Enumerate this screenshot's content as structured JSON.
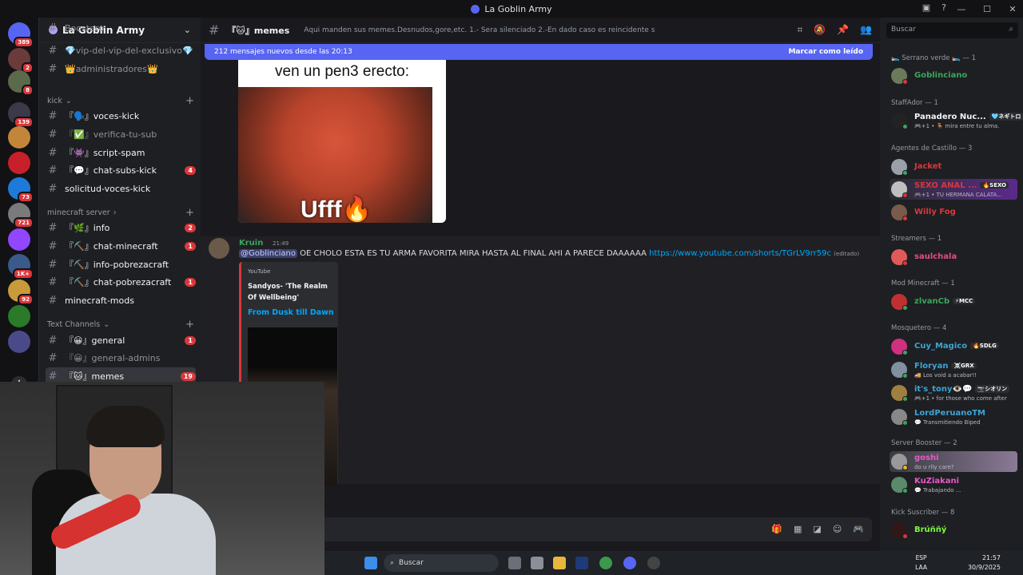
{
  "window": {
    "title": "La Goblin Army"
  },
  "servers": [
    {
      "badge": "389",
      "color": "#5865f2"
    },
    {
      "badge": "2",
      "color": "#6b3a3a"
    },
    {
      "badge": "8",
      "color": "#5a6a4a"
    },
    {
      "badge": "139",
      "color": "#3a3a4a"
    },
    {
      "badge": "",
      "color": "#c2853a"
    },
    {
      "badge": "",
      "color": "#c8202a"
    },
    {
      "badge": "73",
      "color": "#1e7ad8"
    },
    {
      "badge": "721",
      "color": "#7a7a7a"
    },
    {
      "badge": "",
      "color": "#9146ff"
    },
    {
      "badge": "1K+",
      "color": "#3a5a8a"
    },
    {
      "badge": "92",
      "color": "#c89a3a"
    },
    {
      "badge": "",
      "color": "#2a7a2a"
    },
    {
      "badge": "",
      "color": "#4a4a8a"
    }
  ],
  "guild": {
    "name": "La Goblin Army"
  },
  "channels": {
    "top": [
      {
        "label": "Boostero",
        "dim": true
      },
      {
        "label": "💎vip-del-vip-del-exclusivo💎",
        "dim": true
      },
      {
        "label": "👑administradores👑",
        "dim": true
      }
    ],
    "categories": [
      {
        "label": "kick",
        "chevron": "⌄"
      },
      {
        "label": "minecraft server",
        "chevron": "›"
      },
      {
        "label": "Text Channels",
        "chevron": "⌄"
      }
    ],
    "kick": [
      {
        "label": "『🗣️』voces-kick",
        "badge": "",
        "dim": false
      },
      {
        "label": "『✅』verifica-tu-sub",
        "badge": "",
        "dim": true
      },
      {
        "label": "『👾』script-spam",
        "badge": "",
        "dim": false
      },
      {
        "label": "『💬』chat-subs-kick",
        "badge": "4",
        "dim": false
      },
      {
        "label": "solicitud-voces-kick",
        "badge": "",
        "dim": false
      }
    ],
    "minecraft": [
      {
        "label": "『🌿』info",
        "badge": "2"
      },
      {
        "label": "『⛏️』chat-minecraft",
        "badge": "1"
      },
      {
        "label": "『⛏️』info-pobrezacraft",
        "badge": ""
      },
      {
        "label": "『⛏️』chat-pobrezacraft",
        "badge": "1"
      },
      {
        "label": "minecraft-mods",
        "badge": ""
      }
    ],
    "text": [
      {
        "label": "『😀』general",
        "badge": "1",
        "dim": false
      },
      {
        "label": "『😀』general-admins",
        "badge": "",
        "dim": true
      },
      {
        "label": "『🐱』memes",
        "badge": "19",
        "dim": false
      }
    ]
  },
  "topbar": {
    "channel": "『🐱』memes",
    "topic": "Aqui manden sus memes.Desnudos,gore,etc. 1.- Sera silenciado 2.-En dado caso es reincidente sera baneado"
  },
  "newbar": {
    "text": "212 mensajes nuevos desde las 20:13",
    "mark": "Marcar como leído"
  },
  "meme": {
    "caption": "ven un pen3 erecto:",
    "overlay": "Ufff🔥"
  },
  "message": {
    "author": "Kruin",
    "time": "21:49",
    "mention": "@Goblinciano",
    "text": " OE CHOLO ESTA ES TU ARMA FAVORITA MIRA HASTA AL FINAL AHI A PARECE DAAAAAA ",
    "link": "https://www.youtube.com/shorts/TGrLV9rr59c",
    "edited": "(editado)",
    "embed": {
      "provider": "YouTube",
      "title": "Sandyos- 'The Realm Of Wellbeing'",
      "link": "From Dusk till Dawn"
    }
  },
  "search": {
    "placeholder": "Buscar"
  },
  "members": {
    "groups": [
      {
        "header": "🛌 Serrano verde 🛌 — 1"
      },
      {
        "header": "StaffAdor — 1"
      },
      {
        "header": "Agentes de Castillo — 3"
      },
      {
        "header": "Streamers — 1"
      },
      {
        "header": "Mod Minecraft — 1"
      },
      {
        "header": "Mosquetero — 4"
      },
      {
        "header": "Server Booster — 2"
      },
      {
        "header": "Kick Suscriber — 8"
      }
    ],
    "list": [
      {
        "name": "Goblinciano",
        "tag": "",
        "status": "",
        "color": "#3ba55d"
      },
      {
        "name": "Panadero Nuc...",
        "tag": "🩵ネギトロ",
        "status": "🎮+1 • 🪑 mira entre tu alma.",
        "color": "#f2f3f5"
      },
      {
        "name": "Jacket",
        "tag": "",
        "status": "",
        "color": "#da373c"
      },
      {
        "name": "SEXO ANAL ...",
        "tag": "🔥SEXO",
        "status": "🎮+1 • TU HERMANA CALATA...",
        "color": "#da373c"
      },
      {
        "name": "Willy Fog",
        "tag": "",
        "status": "",
        "color": "#da373c"
      },
      {
        "name": "saulchala",
        "tag": "",
        "status": "",
        "color": "#e84a8a"
      },
      {
        "name": "zlvanCb",
        "tag": "⚡MCC",
        "status": "",
        "color": "#3ba55d"
      },
      {
        "name": "Cuy_Magico",
        "tag": "🔥SDLG",
        "status": "",
        "color": "#3ba5d8"
      },
      {
        "name": "Floryan",
        "tag": "☠️GRX",
        "status": "🚚 Los void a acabar!!",
        "color": "#3ba5d8"
      },
      {
        "name": "it's_tony👁️💬",
        "tag": "📷シオリン",
        "status": "🎮+1 • for those who come after",
        "color": "#3ba5d8"
      },
      {
        "name": "LordPeruanoTM",
        "tag": "",
        "status": "💬 Transmitiendo Biped",
        "color": "#3ba5d8"
      },
      {
        "name": "goshi",
        "tag": "",
        "status": "do u rlly care?",
        "color": "#e858c8"
      },
      {
        "name": "KuZiakani",
        "tag": "",
        "status": "💬 Trabajando ...",
        "color": "#e858c8"
      },
      {
        "name": "Brúññý",
        "tag": "",
        "status": "",
        "color": "#7cfc3c"
      }
    ]
  },
  "taskbar": {
    "search": "Buscar",
    "lang1": "ESP",
    "lang2": "LAA",
    "time": "21:57",
    "date": "30/9/2025"
  }
}
